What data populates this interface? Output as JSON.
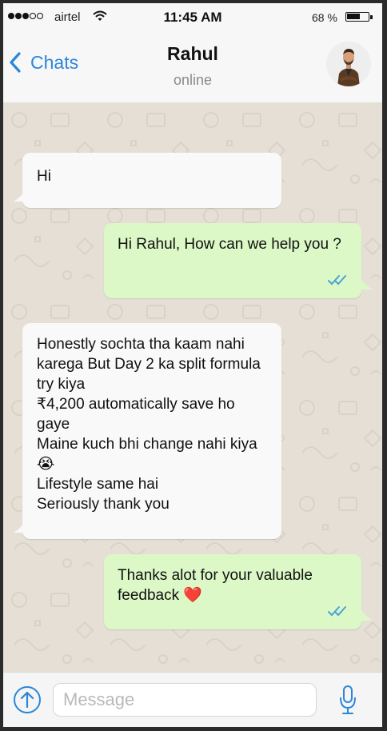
{
  "status_bar": {
    "carrier": "airtel",
    "time": "11:45 AM",
    "battery_text": "68 %",
    "battery_level": 0.68,
    "signal_filled": 3,
    "signal_total": 5
  },
  "header": {
    "back_label": "Chats",
    "contact_name": "Rahul",
    "contact_status": "online"
  },
  "messages": [
    {
      "direction": "in",
      "text": "Hi"
    },
    {
      "direction": "out",
      "text": "Hi Rahul, How can we help you ?",
      "ticks": "double-check"
    },
    {
      "direction": "in",
      "lines": [
        "Honestly sochta tha kaam nahi karega But Day 2 ka split formula try kiya",
        "₹4,200 automatically save ho gaye",
        "Maine kuch bhi change nahi kiya 😭",
        "Lifestyle same hai",
        "Seriously thank you"
      ]
    },
    {
      "direction": "out",
      "text": "Thanks alot for your valuable feedback ❤️",
      "ticks": "double-check"
    }
  ],
  "input": {
    "placeholder": "Message"
  },
  "colors": {
    "accent": "#2b86d9",
    "incoming_bubble": "#f9f9f9",
    "outgoing_bubble": "#dcf8c6",
    "chat_background": "#e5dfd6",
    "read_ticks": "#4aa3d8",
    "heart": "#e8336e"
  },
  "icons": [
    "signal-dots",
    "wifi-icon",
    "battery-icon",
    "back-chevron-icon",
    "avatar",
    "double-check-icon",
    "upload-arrow-icon",
    "microphone-icon"
  ]
}
